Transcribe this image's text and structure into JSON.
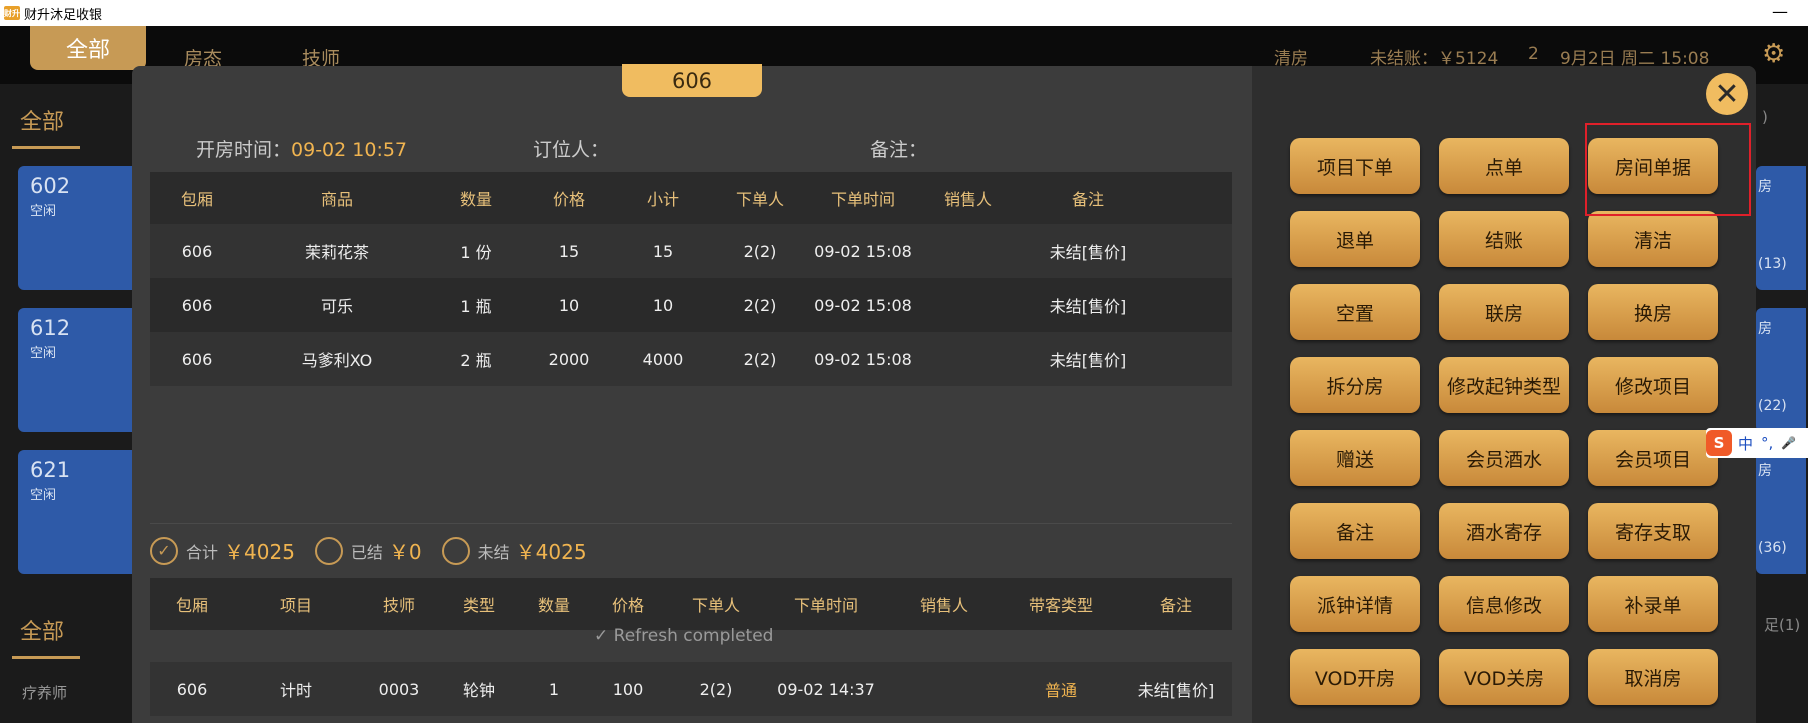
{
  "window": {
    "title": "财升沐足收银",
    "app_icon": "财升",
    "minimize": "—"
  },
  "topbar": {
    "tab_all": "全部",
    "nav_room": "房态",
    "nav_tech": "技师",
    "clean": "清房",
    "unpaid": "未结账：￥5124",
    "count": "2",
    "datetime": "9月2日 周二 15:08",
    "settings_icon": "gear-icon"
  },
  "left": {
    "header1": "全部",
    "header2": "全部",
    "therapist": "疗养师",
    "rooms": [
      {
        "num": "602",
        "status": "空闲"
      },
      {
        "num": "612",
        "status": "空闲"
      },
      {
        "num": "621",
        "status": "空闲"
      }
    ]
  },
  "right": {
    "cards": [
      "房",
      "(13)",
      "房",
      "(22)",
      "房",
      "(36)"
    ],
    "tag1": ")",
    "tag2": "足(1)"
  },
  "modal": {
    "room": "606",
    "open_time_label": "开房时间：",
    "open_time": "09-02 10:57",
    "booker_label": "订位人：",
    "note_label": "备注：",
    "orders": {
      "headers": [
        "包厢",
        "商品",
        "数量",
        "价格",
        "小计",
        "下单人",
        "下单时间",
        "销售人",
        "备注"
      ],
      "rows": [
        [
          "606",
          "茉莉花茶",
          "1 份",
          "15",
          "15",
          "2(2)",
          "09-02 15:08",
          "",
          "未结[售价]"
        ],
        [
          "606",
          "可乐",
          "1 瓶",
          "10",
          "10",
          "2(2)",
          "09-02 15:08",
          "",
          "未结[售价]"
        ],
        [
          "606",
          "马爹利XO",
          "2 瓶",
          "2000",
          "4000",
          "2(2)",
          "09-02 15:08",
          "",
          "未结[售价]"
        ]
      ]
    },
    "summary": {
      "total_label": "合计",
      "total": "￥4025",
      "paid_label": "已结",
      "paid": "￥0",
      "unpaid_label": "未结",
      "unpaid": "￥4025"
    },
    "services": {
      "headers": [
        "包厢",
        "项目",
        "技师",
        "类型",
        "数量",
        "价格",
        "下单人",
        "下单时间",
        "销售人",
        "带客类型",
        "备注"
      ],
      "rows": [
        [
          "606",
          "计时",
          "0003",
          "轮钟",
          "1",
          "100",
          "2(2)",
          "09-02 14:37",
          "",
          "普通",
          "未结[售价]"
        ]
      ]
    },
    "refresh": "Refresh completed",
    "close_icon": "close-icon",
    "buttons": [
      "项目下单",
      "点单",
      "房间单据",
      "退单",
      "结账",
      "清洁",
      "空置",
      "联房",
      "换房",
      "拆分房",
      "修改起钟类型",
      "修改项目",
      "赠送",
      "会员酒水",
      "会员项目",
      "备注",
      "酒水寄存",
      "寄存支取",
      "派钟详情",
      "信息修改",
      "补录单",
      "VOD开房",
      "VOD关房",
      "取消房"
    ]
  },
  "ime": {
    "logo": "S",
    "mode": "中",
    "punct": "°,",
    "mic": "🎤"
  },
  "colors": {
    "accent": "#f0bc60",
    "card_blue": "#2e5aa8",
    "highlight": "#e0202a"
  }
}
